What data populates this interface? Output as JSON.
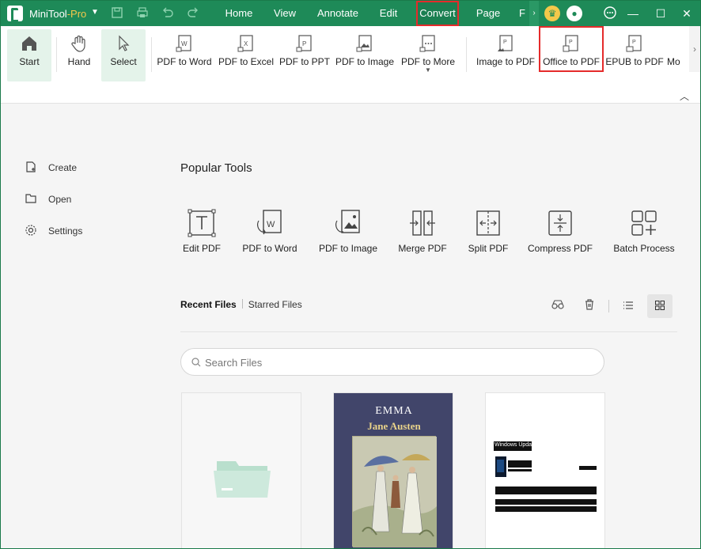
{
  "titlebar": {
    "app_name": "MiniTool",
    "app_edition": "-Pro",
    "menu": [
      "Home",
      "View",
      "Annotate",
      "Edit",
      "Convert",
      "Page",
      "F"
    ],
    "active_menu": "Convert"
  },
  "ribbon": {
    "tools": [
      {
        "label": "Start"
      },
      {
        "label": "Hand"
      },
      {
        "label": "Select"
      },
      {
        "label": "PDF to Word"
      },
      {
        "label": "PDF to Excel"
      },
      {
        "label": "PDF to PPT"
      },
      {
        "label": "PDF to Image"
      },
      {
        "label": "PDF to More"
      },
      {
        "label": "Image to PDF"
      },
      {
        "label": "Office to PDF"
      },
      {
        "label": "EPUB to PDF"
      },
      {
        "label": "Mo"
      }
    ]
  },
  "sidebar": {
    "items": [
      {
        "label": "Create",
        "icon": "create-icon"
      },
      {
        "label": "Open",
        "icon": "folder-icon"
      },
      {
        "label": "Settings",
        "icon": "gear-icon"
      }
    ]
  },
  "main": {
    "section_title": "Popular Tools",
    "popular_tools": [
      {
        "label": "Edit PDF",
        "icon": "text-edit-icon"
      },
      {
        "label": "PDF to Word",
        "icon": "pdf-to-word-icon"
      },
      {
        "label": "PDF to Image",
        "icon": "pdf-to-image-icon"
      },
      {
        "label": "Merge PDF",
        "icon": "merge-icon"
      },
      {
        "label": "Split PDF",
        "icon": "split-icon"
      },
      {
        "label": "Compress PDF",
        "icon": "compress-icon"
      },
      {
        "label": "Batch Process",
        "icon": "batch-icon"
      }
    ],
    "tabs": [
      "Recent Files",
      "Starred Files"
    ],
    "active_tab": "Recent Files",
    "search": {
      "placeholder": "Search Files"
    },
    "book": {
      "title": "EMMA",
      "author": "Jane Austen"
    },
    "doc_heading": "Windows Update"
  },
  "colors": {
    "brand_green": "#1e8a58",
    "highlight_red": "#e52b2b",
    "selected_tool_bg": "#e4f3ea",
    "pro_label": "#f5c84b"
  }
}
